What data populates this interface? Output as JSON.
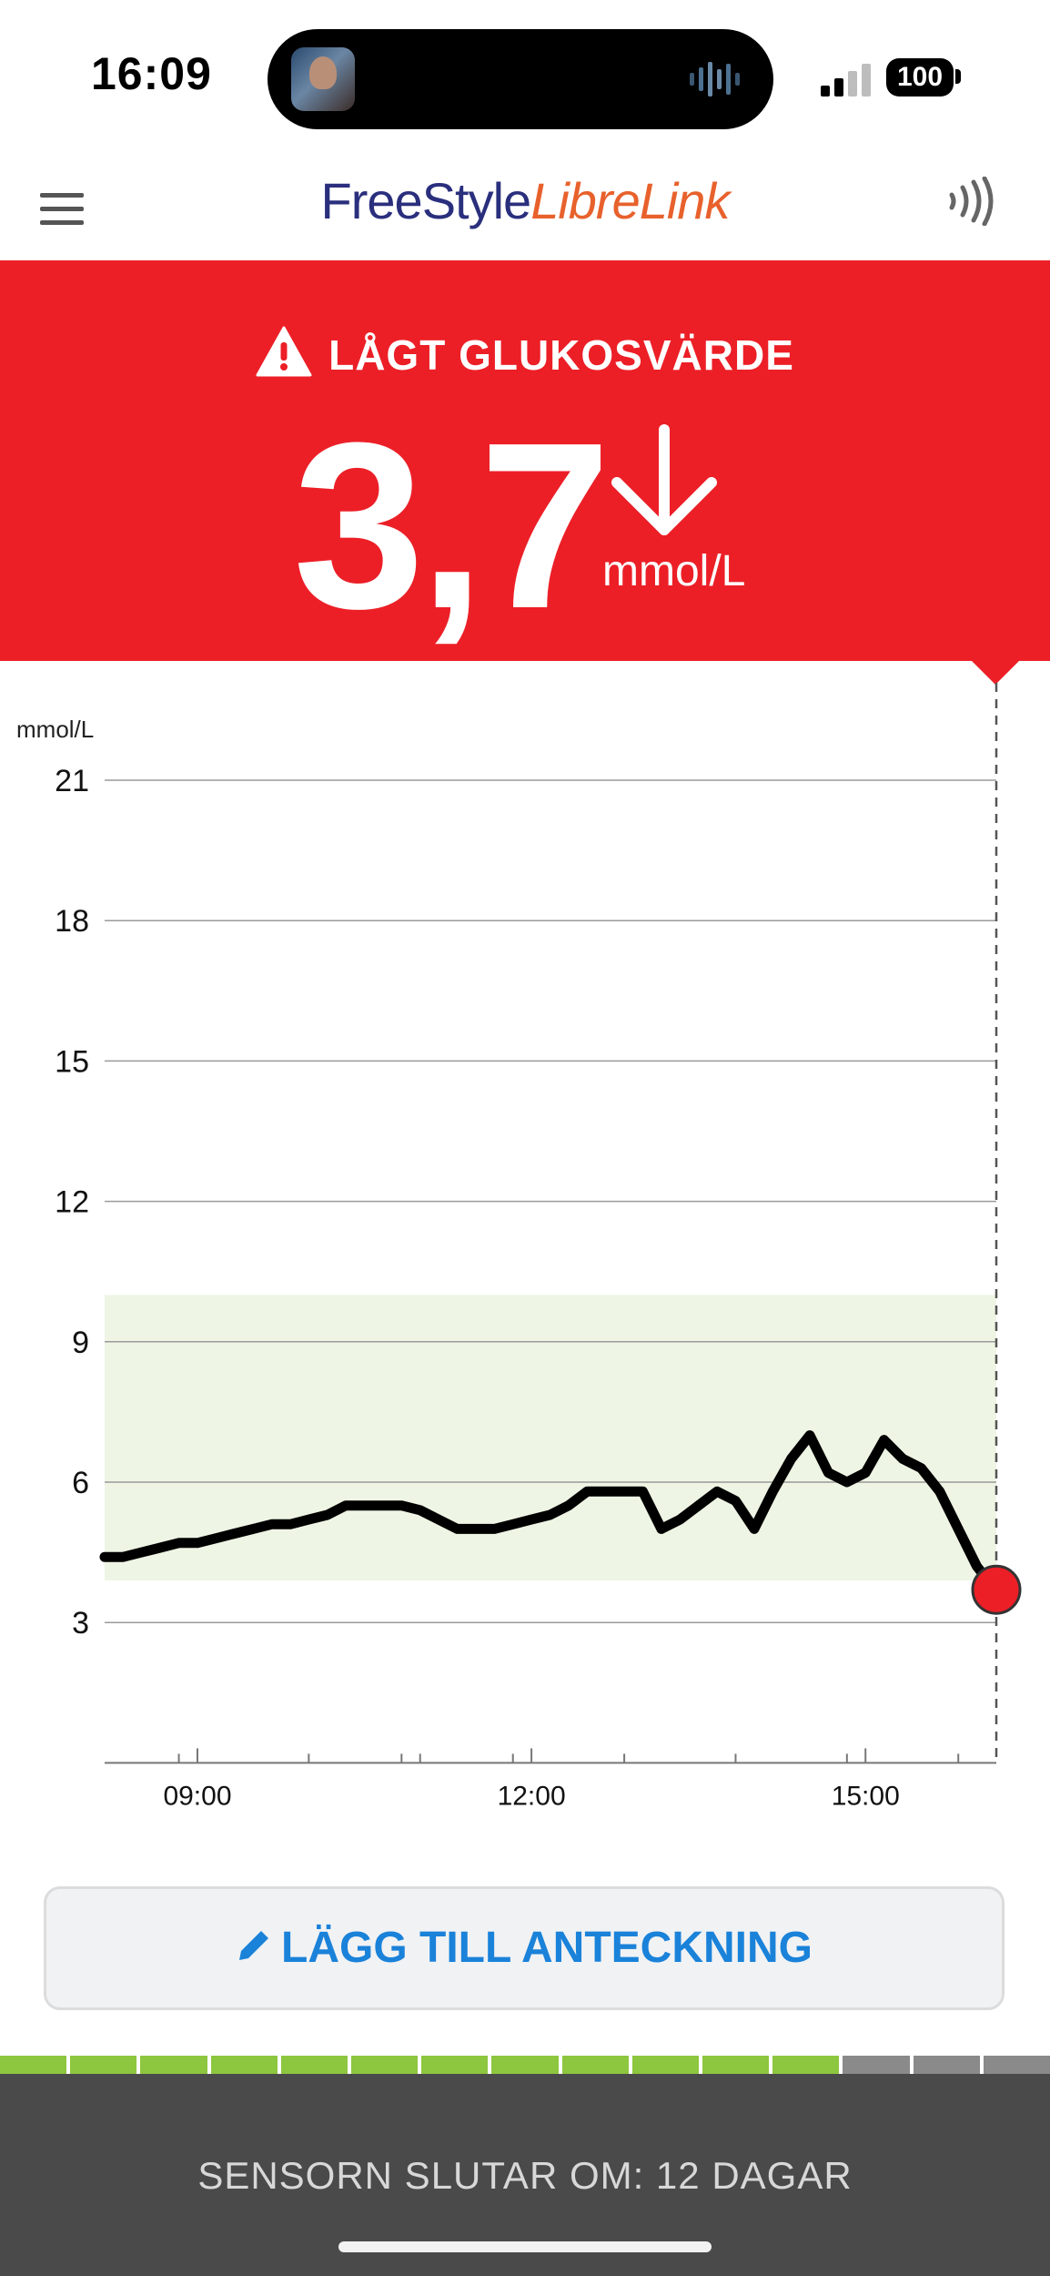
{
  "status_bar": {
    "time": "16:09",
    "battery": "100"
  },
  "header": {
    "brand_part1": "FreeStyle",
    "brand_part2": "LibreLink"
  },
  "alert": {
    "title": "LÅGT GLUKOSVÄRDE",
    "value": "3,7",
    "unit": "mmol/L",
    "trend": "falling",
    "color": "#ec1f27"
  },
  "chart_data": {
    "type": "line",
    "ylabel": "mmol/L",
    "y_ticks": [
      21,
      18,
      15,
      12,
      9,
      6,
      3
    ],
    "x_ticks": [
      "09:00",
      "12:00",
      "15:00"
    ],
    "ylim": [
      0,
      21
    ],
    "target_range": [
      3.9,
      10.0
    ],
    "current_value": 3.7,
    "grid": true,
    "series": [
      {
        "x": [
          "08:10",
          "08:20",
          "08:30",
          "08:40",
          "08:50",
          "09:00",
          "09:10",
          "09:20",
          "09:30",
          "09:40",
          "09:50",
          "10:00",
          "10:10",
          "10:20",
          "10:30",
          "10:40",
          "10:50",
          "11:00",
          "11:10",
          "11:20",
          "11:30",
          "11:40",
          "11:50",
          "12:00",
          "12:10",
          "12:20",
          "12:30",
          "12:40",
          "12:50",
          "13:00",
          "13:10",
          "13:20",
          "13:30",
          "13:40",
          "13:50",
          "14:00",
          "14:10",
          "14:20",
          "14:30",
          "14:40",
          "14:50",
          "15:00",
          "15:10",
          "15:20",
          "15:30",
          "15:40",
          "15:50",
          "16:00",
          "16:10"
        ],
        "values": [
          4.4,
          4.4,
          4.5,
          4.6,
          4.7,
          4.7,
          4.8,
          4.9,
          5.0,
          5.1,
          5.1,
          5.2,
          5.3,
          5.5,
          5.5,
          5.5,
          5.5,
          5.4,
          5.2,
          5.0,
          5.0,
          5.0,
          5.1,
          5.2,
          5.3,
          5.5,
          5.8,
          5.8,
          5.8,
          5.8,
          5.0,
          5.2,
          5.5,
          5.8,
          5.6,
          5.0,
          5.8,
          6.5,
          7.0,
          6.2,
          6.0,
          6.2,
          6.9,
          6.5,
          6.3,
          5.8,
          5.0,
          4.2,
          3.7
        ],
        "color": "#000000"
      }
    ],
    "target_color": "#eef5e4"
  },
  "note_button": {
    "label": "LÄGG TILL ANTECKNING"
  },
  "sensor": {
    "footer": "SENSORN SLUTAR OM: 12 DAGAR",
    "segments_total": 15,
    "segments_used": 12,
    "active_color": "#8dc63f",
    "inactive_color": "#8a8a8a"
  }
}
